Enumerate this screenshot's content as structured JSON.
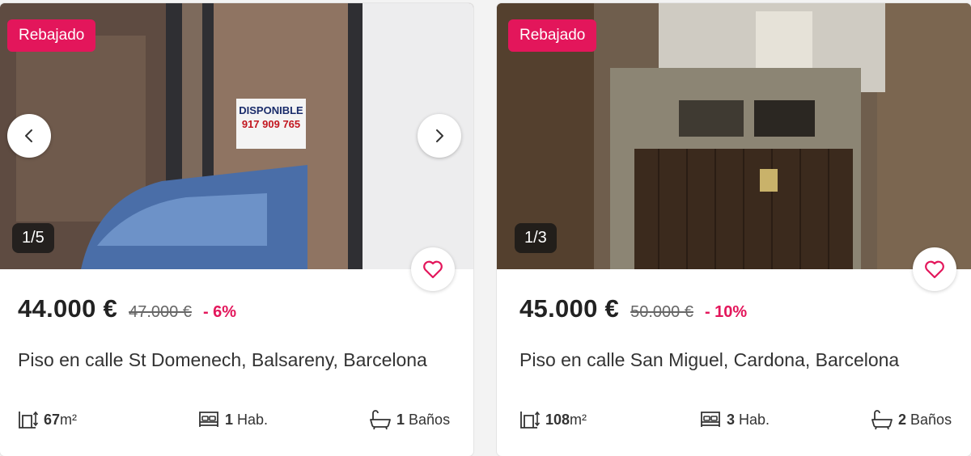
{
  "listings": [
    {
      "badge": "Rebajado",
      "counter": "1/5",
      "price": "44.000 €",
      "old_price": "47.000 €",
      "discount": "- 6%",
      "title": "Piso en calle St Domenech, Balsareny, Barcelona",
      "area_value": "67",
      "area_unit": "m²",
      "rooms_value": "1",
      "rooms_unit": "Hab.",
      "baths_value": "1",
      "baths_unit": "Baños",
      "photo_sign": [
        "DISPONIBLE",
        "917 909 765"
      ]
    },
    {
      "badge": "Rebajado",
      "counter": "1/3",
      "price": "45.000 €",
      "old_price": "50.000 €",
      "discount": "- 10%",
      "title": "Piso en calle San Miguel, Cardona, Barcelona",
      "area_value": "108",
      "area_unit": "m²",
      "rooms_value": "3",
      "rooms_unit": "Hab.",
      "baths_value": "2",
      "baths_unit": "Baños"
    }
  ],
  "colors": {
    "accent": "#e3165b",
    "text": "#333333"
  },
  "icons": [
    "chevron-left-icon",
    "chevron-right-icon",
    "heart-icon",
    "area-icon",
    "bed-icon",
    "bathtub-icon"
  ]
}
